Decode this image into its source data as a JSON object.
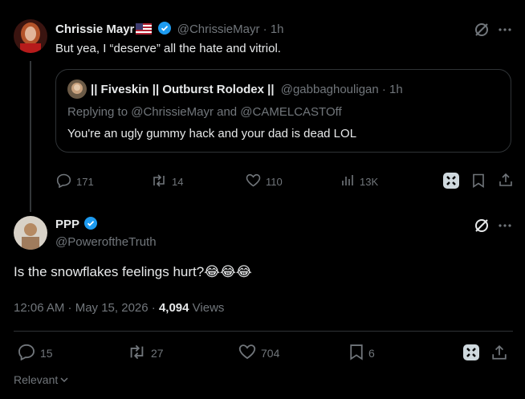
{
  "tweet1": {
    "name": "Chrissie Mayr",
    "handle": "@ChrissieMayr",
    "time": "· 1h",
    "text": "But yea, I “deserve” all the hate and vitriol.",
    "quote": {
      "name": "|| Fiveskin || Outburst Rolodex ||",
      "handle": "@gabbaghouligan",
      "time": "· 1h",
      "replying": "Replying to @ChrissieMayr and @CAMELCASTOff",
      "text": "You're an ugly gummy hack and your dad is dead LOL"
    },
    "actions": {
      "replies": "171",
      "reposts": "14",
      "likes": "110",
      "views": "13K"
    }
  },
  "tweet2": {
    "name": "PPP",
    "handle": "@PoweroftheTruth",
    "text": "Is the snowflakes feelings hurt?😂😂😂",
    "timestamp": "12:06 AM · May 15, 2026 ·",
    "views_count": "4,094",
    "views_label": "Views",
    "actions": {
      "replies": "15",
      "reposts": "27",
      "likes": "704",
      "bookmarks": "6"
    }
  },
  "footer": {
    "sort_label": "Relevant"
  },
  "colors": {
    "accent": "#1d9bf0",
    "muted": "#71767b",
    "text": "#e7e9ea",
    "border": "#2f3336"
  }
}
